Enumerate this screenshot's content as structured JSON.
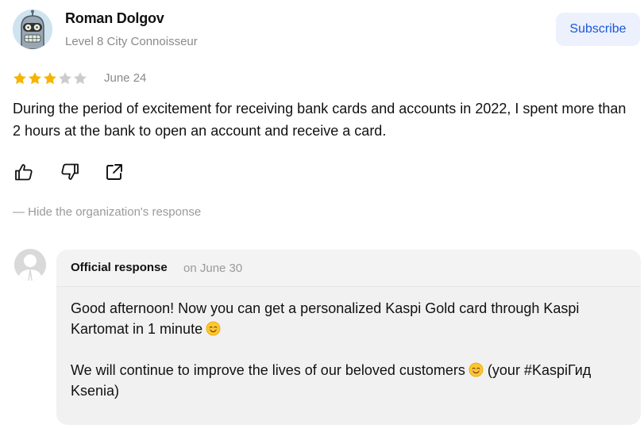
{
  "review": {
    "author_name": "Roman Dolgov",
    "author_level": "Level 8 City Connoisseur",
    "subscribe_label": "Subscribe",
    "rating": 3,
    "rating_max": 5,
    "date": "June 24",
    "text": "During the period of excitement for receiving bank cards and accounts in 2022, I spent more than 2 hours at the bank to open an account and receive a card."
  },
  "actions": {
    "like_icon": "thumbs-up-icon",
    "dislike_icon": "thumbs-down-icon",
    "share_icon": "share-icon"
  },
  "hide_response_label": "— Hide the organization's response",
  "response": {
    "title": "Official response",
    "date": "on June 30",
    "paragraph1": "Good afternoon! Now you can get a personalized Kaspi Gold card through Kaspi Kartomat in 1 minute",
    "paragraph2": "We will continue to improve the lives of our beloved customers",
    "paragraph2_tail": "(your #KaspiГид Ksenia)",
    "emoji_icon": "smiling-face-emoji"
  },
  "colors": {
    "star_filled": "#f5b400",
    "star_empty": "#cccccc",
    "accent": "#1a56db",
    "subscribe_bg": "#ecf1fd",
    "muted": "#8a8a8a",
    "response_bg": "#f3f3f3"
  }
}
